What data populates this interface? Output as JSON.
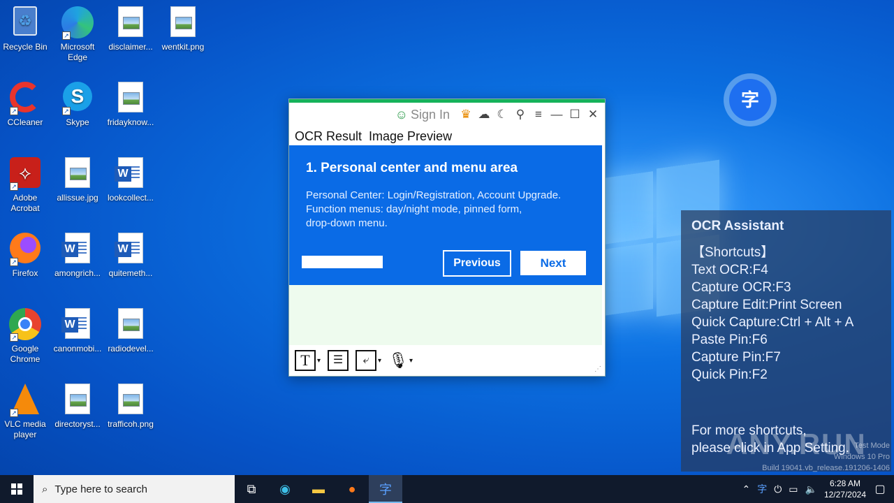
{
  "desktop_icons": [
    {
      "label": "Recycle Bin",
      "icon": "recycle-bin-icon"
    },
    {
      "label": "Microsoft Edge",
      "icon": "edge-icon"
    },
    {
      "label": "disclaimer...",
      "icon": "image-file-icon"
    },
    {
      "label": "wentkit.png",
      "icon": "image-file-icon"
    },
    {
      "label": "CCleaner",
      "icon": "ccleaner-icon"
    },
    {
      "label": "Skype",
      "icon": "skype-icon"
    },
    {
      "label": "fridayknow...",
      "icon": "image-file-icon"
    },
    {
      "label": "Adobe Acrobat",
      "icon": "acrobat-icon"
    },
    {
      "label": "allissue.jpg",
      "icon": "image-file-icon"
    },
    {
      "label": "lookcollect...",
      "icon": "word-doc-icon"
    },
    {
      "label": "Firefox",
      "icon": "firefox-icon"
    },
    {
      "label": "amongrich...",
      "icon": "word-doc-icon"
    },
    {
      "label": "quitemeth...",
      "icon": "word-doc-icon"
    },
    {
      "label": "Google Chrome",
      "icon": "chrome-icon"
    },
    {
      "label": "canonmobi...",
      "icon": "word-doc-icon"
    },
    {
      "label": "radiodevel...",
      "icon": "image-file-icon"
    },
    {
      "label": "VLC media player",
      "icon": "vlc-icon"
    },
    {
      "label": "directoryst...",
      "icon": "image-file-icon"
    },
    {
      "label": "trafficoh.png",
      "icon": "image-file-icon"
    }
  ],
  "ocr_window": {
    "sign_in": "Sign In",
    "tabs": [
      "OCR Result",
      "Image Preview"
    ],
    "guide": {
      "title": "1. Personal center and menu area",
      "body_lines": [
        "Personal Center: Login/Registration, Account Upgrade.",
        "Function menus: day/night mode, pinned form,",
        "drop-down menu."
      ],
      "previous_label": "Previous",
      "next_label": "Next"
    }
  },
  "assistant": {
    "title": "OCR Assistant",
    "lines": [
      "【Shortcuts】",
      "Text OCR:F4",
      "Capture OCR:F3",
      "Capture Edit:Print Screen",
      "Quick Capture:Ctrl + Alt + A",
      "Paste Pin:F6",
      "Capture Pin:F7",
      "Quick Pin:F2"
    ],
    "more_line1": "For more shortcuts,",
    "more_line2": "please click in App Setting."
  },
  "watermark": {
    "line1": "Test Mode",
    "line2": "Windows 10 Pro",
    "line3": "Build 19041.vb_release.191206-1406"
  },
  "anyrun_text": "ANY.RUN",
  "taskbar": {
    "search_placeholder": "Type here to search",
    "time": "6:28 AM",
    "date": "12/27/2024"
  }
}
